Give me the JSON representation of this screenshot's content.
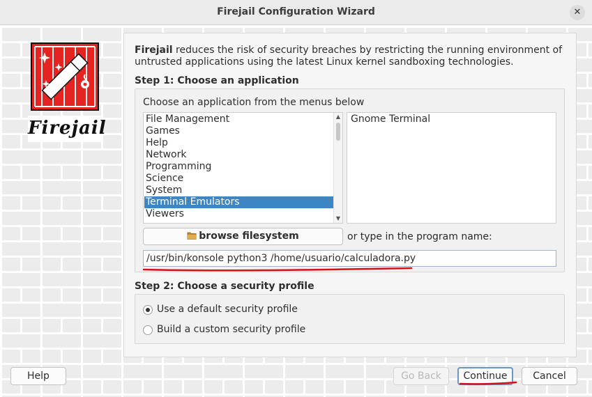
{
  "window": {
    "title": "Firejail Configuration Wizard",
    "close_glyph": "✕"
  },
  "logo": {
    "text": "Firejail"
  },
  "intro": {
    "brand": "Firejail",
    "text": " reduces the risk of security breaches by restricting the running environment of untrusted applications using the latest Linux kernel sandboxing technologies."
  },
  "step1": {
    "heading": "Step 1: Choose an application",
    "group_label": "Choose an application from the menus below",
    "categories": [
      "File Management",
      "Games",
      "Help",
      "Network",
      "Programming",
      "Science",
      "System",
      "Terminal Emulators",
      "Viewers"
    ],
    "selected_category": "Terminal Emulators",
    "applications": [
      "Gnome Terminal"
    ],
    "browse_button": "browse filesystem",
    "browse_icon": "folder-icon",
    "or_type_label": "or type in the program name:",
    "program_value": "/usr/bin/konsole python3 /home/usuario/calculadora.py"
  },
  "step2": {
    "heading": "Step 2: Choose a security profile",
    "options": [
      {
        "label": "Use a default security profile",
        "checked": true
      },
      {
        "label": "Build a custom security profile",
        "checked": false
      }
    ]
  },
  "buttons": {
    "help": "Help",
    "go_back": "Go Back",
    "continue": "Continue",
    "cancel": "Cancel"
  },
  "colors": {
    "selection": "#3d86c6",
    "logo_red": "#e52421",
    "annotation_red": "#d31212"
  }
}
